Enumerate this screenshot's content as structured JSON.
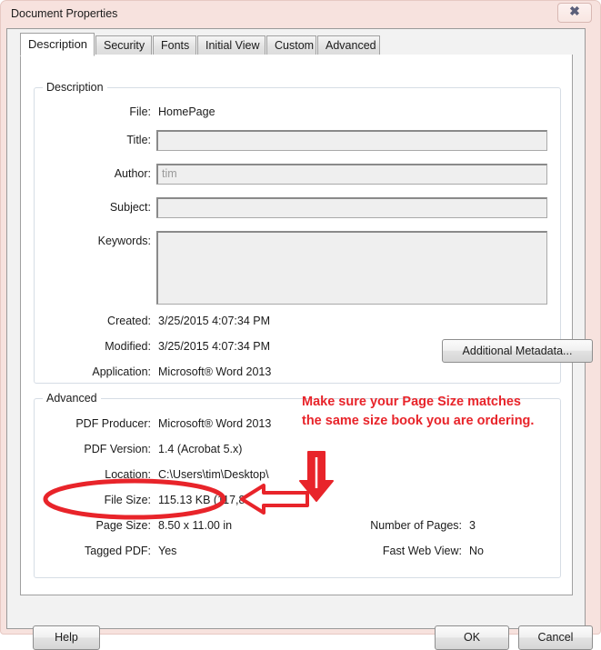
{
  "window": {
    "title": "Document Properties",
    "close_icon": "close-icon",
    "close_glyph": "✖"
  },
  "tabs": [
    {
      "label": "Description",
      "active": true
    },
    {
      "label": "Security",
      "active": false
    },
    {
      "label": "Fonts",
      "active": false
    },
    {
      "label": "Initial View",
      "active": false
    },
    {
      "label": "Custom",
      "active": false
    },
    {
      "label": "Advanced",
      "active": false
    }
  ],
  "description_group": {
    "legend": "Description",
    "file": {
      "label": "File:",
      "value": "HomePage"
    },
    "title": {
      "label": "Title:",
      "value": "",
      "placeholder": ""
    },
    "author": {
      "label": "Author:",
      "value": "tim",
      "placeholder": "tim"
    },
    "subject": {
      "label": "Subject:",
      "value": "",
      "placeholder": ""
    },
    "keywords": {
      "label": "Keywords:",
      "value": "",
      "placeholder": ""
    },
    "created": {
      "label": "Created:",
      "value": "3/25/2015 4:07:34 PM"
    },
    "modified": {
      "label": "Modified:",
      "value": "3/25/2015 4:07:34 PM"
    },
    "application": {
      "label": "Application:",
      "value": "Microsoft® Word 2013"
    },
    "additional_metadata_button": "Additional Metadata..."
  },
  "advanced_group": {
    "legend": "Advanced",
    "rows_left": [
      {
        "label": "PDF Producer:",
        "value": "Microsoft® Word 2013"
      },
      {
        "label": "PDF Version:",
        "value": "1.4 (Acrobat 5.x)"
      },
      {
        "label": "Location:",
        "value": "C:\\Users\\tim\\Desktop\\"
      },
      {
        "label": "File Size:",
        "value": "115.13 KB (117,898 Bytes)"
      },
      {
        "label": "Page Size:",
        "value": "8.50 x 11.00 in"
      },
      {
        "label": "Tagged PDF:",
        "value": "Yes"
      }
    ],
    "rows_right": [
      {
        "label": "Number of Pages:",
        "value": "3"
      },
      {
        "label": "Fast Web View:",
        "value": "No"
      }
    ]
  },
  "footer": {
    "help": "Help",
    "ok": "OK",
    "cancel": "Cancel"
  },
  "annotation": {
    "text": "Make sure your Page Size matches the same size book you are ordering.",
    "color": "#e8242a",
    "shapes": [
      "ellipse-highlight",
      "left-arrow",
      "down-arrow"
    ]
  }
}
